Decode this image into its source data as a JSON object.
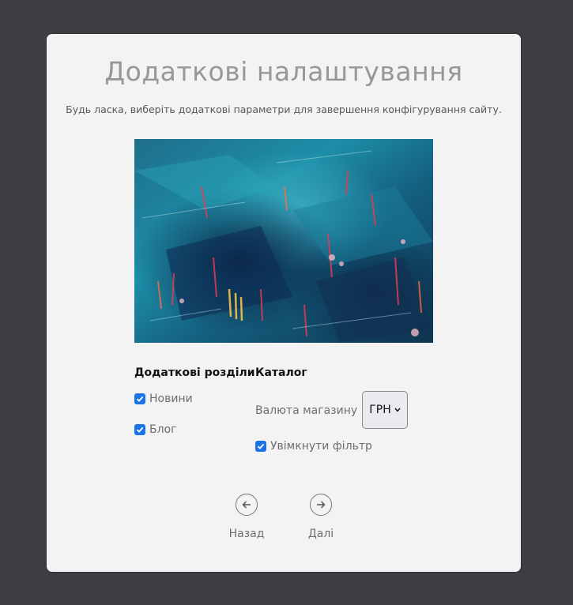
{
  "header": {
    "title": "Додаткові налаштування",
    "subtitle": "Будь ласка, виберіть додаткові параметри для завершення конфігурування сайту."
  },
  "image": {
    "description_icon": "abstract-painting"
  },
  "sections": {
    "extra_sections": {
      "heading": "Додаткові розділи",
      "items": [
        {
          "label": "Новини",
          "checked": true
        },
        {
          "label": "Блог",
          "checked": true
        }
      ]
    },
    "catalog": {
      "heading": "Каталог",
      "currency_label": "Валюта магазину",
      "currency_value": "ГРН",
      "filter_label": "Увімкнути фільтр",
      "filter_checked": true
    }
  },
  "nav": {
    "back_label": "Назад",
    "next_label": "Далі"
  },
  "colors": {
    "background": "#3d3e43",
    "card": "#f3f3f3",
    "checkbox": "#1b73e8",
    "title": "#979797"
  }
}
